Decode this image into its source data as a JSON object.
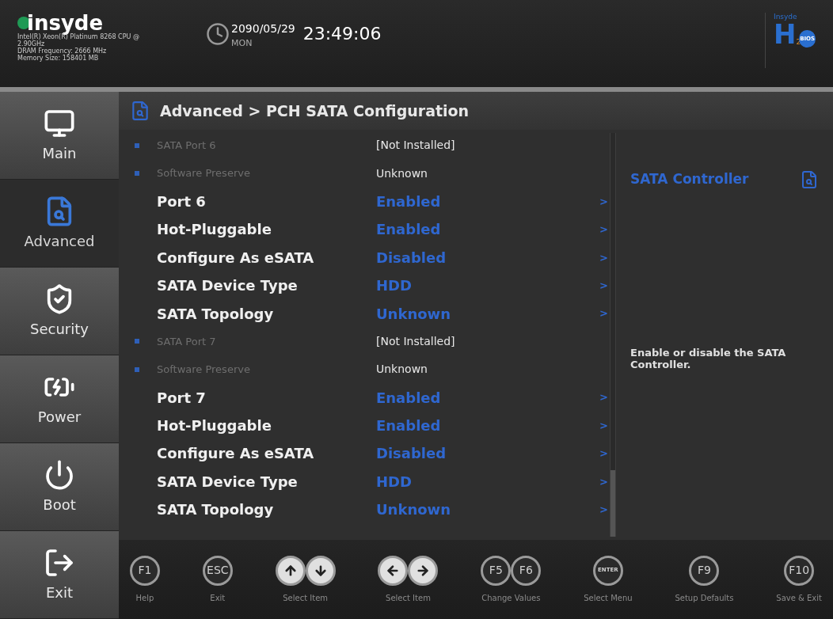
{
  "header": {
    "brand": "insyde",
    "system_info": [
      "Intel(R) Xeon(R) Platinum 8268 CPU @ 2.90GHz",
      "DRAM Frequency: 2666 MHz",
      "Memory Size: 158401 MB"
    ],
    "date": "2090/05/29",
    "weekday": "MON",
    "time": "23:49:06",
    "bios_logo": {
      "top": "Insyde",
      "letter": "H",
      "subscript": "2",
      "badge": "BIOS"
    }
  },
  "sidebar": {
    "items": [
      {
        "kind": "main",
        "label": "Main",
        "selected": false
      },
      {
        "kind": "advanced",
        "label": "Advanced",
        "selected": true
      },
      {
        "kind": "security",
        "label": "Security",
        "selected": false
      },
      {
        "kind": "power",
        "label": "Power",
        "selected": false
      },
      {
        "kind": "boot",
        "label": "Boot",
        "selected": false
      },
      {
        "kind": "exit",
        "label": "Exit",
        "selected": false
      }
    ]
  },
  "breadcrumb": "Advanced > PCH SATA Configuration",
  "settings": [
    {
      "kind": "info",
      "label": "SATA Port 6",
      "value": "[Not Installed]"
    },
    {
      "kind": "info",
      "label": "Software Preserve",
      "value": "Unknown"
    },
    {
      "kind": "option",
      "label": "Port 6",
      "value": "Enabled",
      "arrow": ">"
    },
    {
      "kind": "option",
      "label": "Hot-Pluggable",
      "value": "Enabled",
      "arrow": ">"
    },
    {
      "kind": "option",
      "label": "Configure As eSATA",
      "value": "Disabled",
      "arrow": ">"
    },
    {
      "kind": "option",
      "label": "SATA Device Type",
      "value": "HDD",
      "arrow": ">"
    },
    {
      "kind": "option",
      "label": "SATA Topology",
      "value": "Unknown",
      "arrow": ">"
    },
    {
      "kind": "info",
      "label": "SATA Port 7",
      "value": "[Not Installed]"
    },
    {
      "kind": "info",
      "label": "Software Preserve",
      "value": "Unknown"
    },
    {
      "kind": "option",
      "label": "Port 7",
      "value": "Enabled",
      "arrow": ">"
    },
    {
      "kind": "option",
      "label": "Hot-Pluggable",
      "value": "Enabled",
      "arrow": ">"
    },
    {
      "kind": "option",
      "label": "Configure As eSATA",
      "value": "Disabled",
      "arrow": ">"
    },
    {
      "kind": "option",
      "label": "SATA Device Type",
      "value": "HDD",
      "arrow": ">"
    },
    {
      "kind": "option",
      "label": "SATA Topology",
      "value": "Unknown",
      "arrow": ">"
    }
  ],
  "help": {
    "title": "SATA Controller",
    "description": "Enable or disable the SATA Controller."
  },
  "footer": {
    "hints": [
      {
        "keys": [
          {
            "kind": "text",
            "text": "F1"
          }
        ],
        "label": "Help"
      },
      {
        "keys": [
          {
            "kind": "text",
            "text": "ESC"
          }
        ],
        "label": "Exit"
      },
      {
        "keys": [
          {
            "kind": "arrow_up"
          },
          {
            "kind": "arrow_down"
          }
        ],
        "label": "Select Item"
      },
      {
        "keys": [
          {
            "kind": "arrow_left"
          },
          {
            "kind": "arrow_right"
          }
        ],
        "label": "Select Item"
      },
      {
        "keys": [
          {
            "kind": "text",
            "text": "F5"
          },
          {
            "kind": "text",
            "text": "F6"
          }
        ],
        "label": "Change Values"
      },
      {
        "keys": [
          {
            "kind": "text",
            "text": "ENTER"
          }
        ],
        "label": "Select Menu"
      },
      {
        "keys": [
          {
            "kind": "text",
            "text": "F9"
          }
        ],
        "label": "Setup Defaults"
      },
      {
        "keys": [
          {
            "kind": "text",
            "text": "F10"
          }
        ],
        "label": "Save & Exit"
      }
    ]
  }
}
